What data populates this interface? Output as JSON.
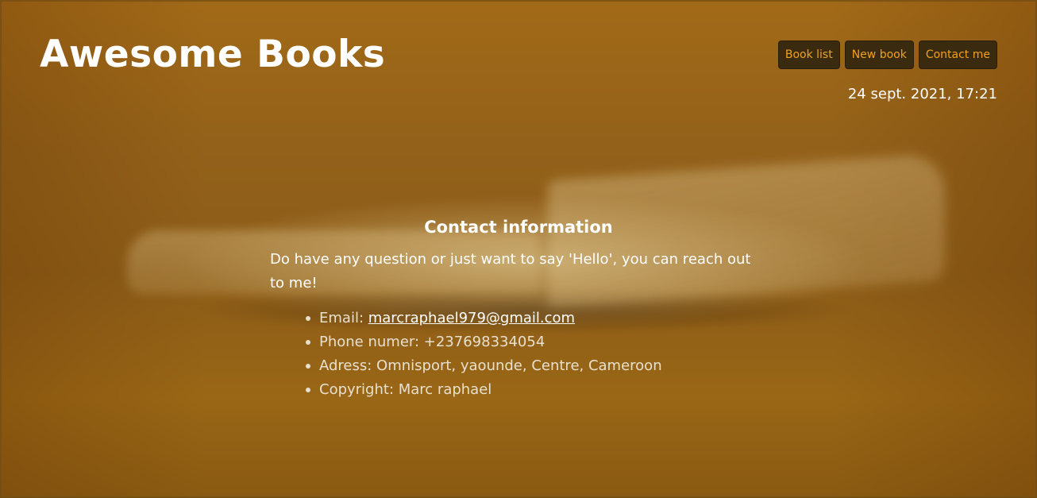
{
  "header": {
    "title": "Awesome Books",
    "date": "24 sept. 2021, 17:21"
  },
  "nav": {
    "book_list": "Book list",
    "new_book": "New book",
    "contact_me": "Contact me"
  },
  "contact": {
    "title": "Contact information",
    "intro": "Do have any question or just want to say 'Hello', you can reach out to me!",
    "email_label": "Email: ",
    "email_value": "marcraphael979@gmail.com",
    "phone": "Phone numer: +237698334054",
    "address": "Adress: Omnisport, yaounde, Centre, Cameroon",
    "copyright": "Copyright: Marc raphael"
  },
  "colors": {
    "background": "#8a5a14",
    "nav_button_bg": "#3a2a0f",
    "nav_button_text": "#f0a21e",
    "text": "#ffffff"
  }
}
